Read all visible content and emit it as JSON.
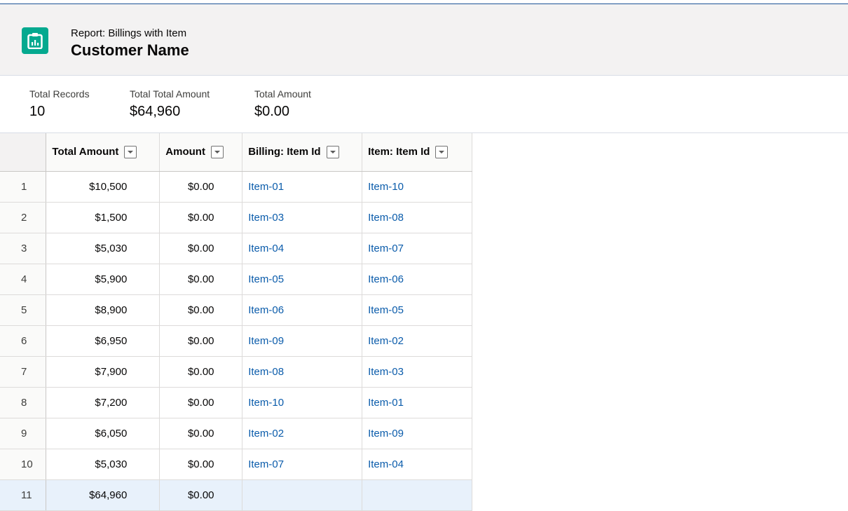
{
  "header": {
    "subtitle": "Report: Billings with Item",
    "title": "Customer Name",
    "icon": "report-icon",
    "icon_color": "#04a98f"
  },
  "summary": [
    {
      "label": "Total Records",
      "value": "10"
    },
    {
      "label": "Total Total Amount",
      "value": "$64,960"
    },
    {
      "label": "Total Amount",
      "value": "$0.00"
    }
  ],
  "table": {
    "columns": [
      {
        "label": "Total Amount"
      },
      {
        "label": "Amount"
      },
      {
        "label": "Billing: Item Id"
      },
      {
        "label": "Item: Item Id"
      }
    ],
    "rows": [
      {
        "n": "1",
        "total": "$10,500",
        "amount": "$0.00",
        "billing": "Item-01",
        "item": "Item-10"
      },
      {
        "n": "2",
        "total": "$1,500",
        "amount": "$0.00",
        "billing": "Item-03",
        "item": "Item-08"
      },
      {
        "n": "3",
        "total": "$5,030",
        "amount": "$0.00",
        "billing": "Item-04",
        "item": "Item-07"
      },
      {
        "n": "4",
        "total": "$5,900",
        "amount": "$0.00",
        "billing": "Item-05",
        "item": "Item-06"
      },
      {
        "n": "5",
        "total": "$8,900",
        "amount": "$0.00",
        "billing": "Item-06",
        "item": "Item-05"
      },
      {
        "n": "6",
        "total": "$6,950",
        "amount": "$0.00",
        "billing": "Item-09",
        "item": "Item-02"
      },
      {
        "n": "7",
        "total": "$7,900",
        "amount": "$0.00",
        "billing": "Item-08",
        "item": "Item-03"
      },
      {
        "n": "8",
        "total": "$7,200",
        "amount": "$0.00",
        "billing": "Item-10",
        "item": "Item-01"
      },
      {
        "n": "9",
        "total": "$6,050",
        "amount": "$0.00",
        "billing": "Item-02",
        "item": "Item-09"
      },
      {
        "n": "10",
        "total": "$5,030",
        "amount": "$0.00",
        "billing": "Item-07",
        "item": "Item-04"
      }
    ],
    "total_row": {
      "n": "11",
      "total": "$64,960",
      "amount": "$0.00"
    }
  }
}
